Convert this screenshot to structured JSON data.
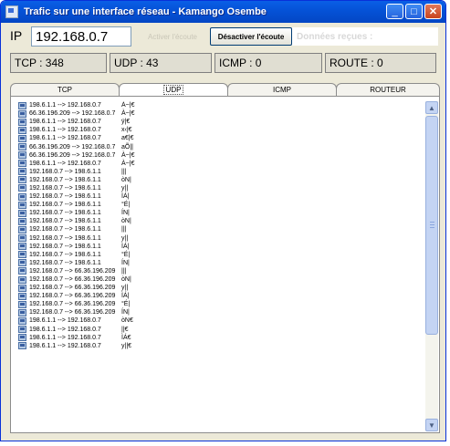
{
  "window": {
    "title": "Trafic sur une interface réseau - Kamango Osembe",
    "minimize": "_",
    "maximize": "□",
    "close": "✕"
  },
  "controls": {
    "ip_label": "IP",
    "ip_value": "192.168.0.7",
    "activate_label": "Activer l'écoute",
    "deactivate_label": "Désactiver l'écoute",
    "received_label": "Données reçues :"
  },
  "stats": {
    "tcp": "TCP : 348",
    "udp": "UDP : 43",
    "icmp": "ICMP : 0",
    "route": "ROUTE : 0"
  },
  "tabs": [
    "TCP",
    "UDP",
    "ICMP",
    "ROUTEUR"
  ],
  "active_tab": "UDP",
  "packets": [
    {
      "addr": "198.6.1.1 --> 192.168.0.7",
      "data": "À~|€"
    },
    {
      "addr": "66.36.196.209 --> 192.168.0.7",
      "data": "À~|€"
    },
    {
      "addr": "198.6.1.1 --> 192.168.0.7",
      "data": "ÿ|€"
    },
    {
      "addr": "198.6.1.1 --> 192.168.0.7",
      "data": "x‹|€"
    },
    {
      "addr": "198.6.1.1 --> 192.168.0.7",
      "data": "a€|€"
    },
    {
      "addr": "66.36.196.209 --> 192.168.0.7",
      "data": "aÕ||"
    },
    {
      "addr": "66.36.196.209 --> 192.168.0.7",
      "data": "À~|€"
    },
    {
      "addr": "198.6.1.1 --> 192.168.0.7",
      "data": "À~|€"
    },
    {
      "addr": "192.168.0.7 --> 198.6.1.1",
      "data": "|||"
    },
    {
      "addr": "192.168.0.7 --> 198.6.1.1",
      "data": "òN|"
    },
    {
      "addr": "192.168.0.7 --> 198.6.1.1",
      "data": "y||"
    },
    {
      "addr": "192.168.0.7 --> 198.6.1.1",
      "data": "ÌÁ|"
    },
    {
      "addr": "192.168.0.7 --> 198.6.1.1",
      "data": "°É|"
    },
    {
      "addr": "192.168.0.7 --> 198.6.1.1",
      "data": "ÍN|"
    },
    {
      "addr": "192.168.0.7 --> 198.6.1.1",
      "data": "òN|"
    },
    {
      "addr": "192.168.0.7 --> 198.6.1.1",
      "data": "|||"
    },
    {
      "addr": "192.168.0.7 --> 198.6.1.1",
      "data": "y||"
    },
    {
      "addr": "192.168.0.7 --> 198.6.1.1",
      "data": "ÌÁ|"
    },
    {
      "addr": "192.168.0.7 --> 198.6.1.1",
      "data": "°É|"
    },
    {
      "addr": "192.168.0.7 --> 198.6.1.1",
      "data": "ÍN|"
    },
    {
      "addr": "192.168.0.7 --> 66.36.196.209",
      "data": "|||"
    },
    {
      "addr": "192.168.0.7 --> 66.36.196.209",
      "data": "òN|"
    },
    {
      "addr": "192.168.0.7 --> 66.36.196.209",
      "data": "y||"
    },
    {
      "addr": "192.168.0.7 --> 66.36.196.209",
      "data": "ÌÁ|"
    },
    {
      "addr": "192.168.0.7 --> 66.36.196.209",
      "data": "°É|"
    },
    {
      "addr": "192.168.0.7 --> 66.36.196.209",
      "data": "ÍN|"
    },
    {
      "addr": "198.6.1.1 --> 192.168.0.7",
      "data": "òN€"
    },
    {
      "addr": "198.6.1.1 --> 192.168.0.7",
      "data": "||€"
    },
    {
      "addr": "198.6.1.1 --> 192.168.0.7",
      "data": "ÌÁ€"
    },
    {
      "addr": "198.6.1.1 --> 192.168.0.7",
      "data": "y||€"
    }
  ]
}
